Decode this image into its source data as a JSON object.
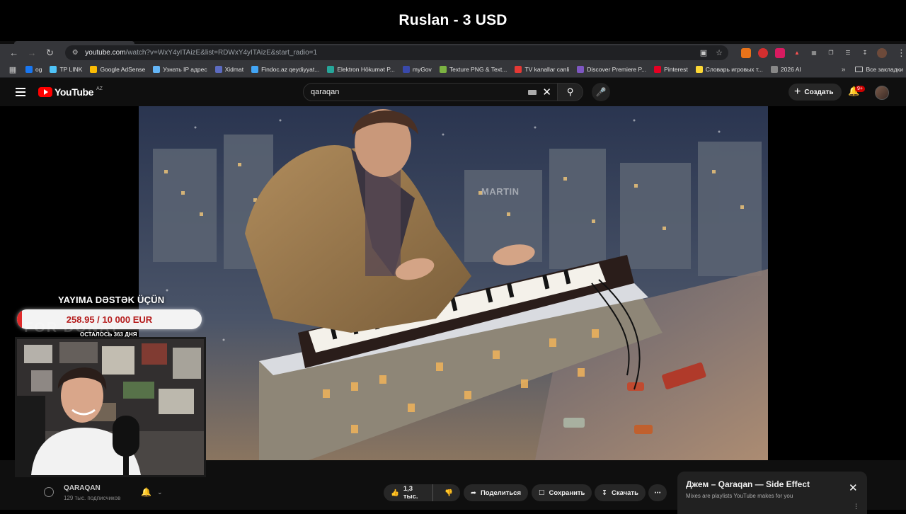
{
  "stream": {
    "title": "Ruslan - 3 USD"
  },
  "browser": {
    "url_host": "youtube.com",
    "url_path": "/watch?v=WxY4yITAizE&list=RDWxY4yITAizE&start_radio=1",
    "bookmarks": [
      {
        "label": "og",
        "color": "#1877f2"
      },
      {
        "label": "TP LINK",
        "color": "#4fc3f7"
      },
      {
        "label": "Google AdSense",
        "color": "#fbbc04"
      },
      {
        "label": "Узнать IP адрес",
        "color": "#64b5f6"
      },
      {
        "label": "Xidmat",
        "color": "#5c6bc0"
      },
      {
        "label": "Findoc.az qeydiyyat...",
        "color": "#42a5f5"
      },
      {
        "label": "Elektron Hökumət P...",
        "color": "#26a69a"
      },
      {
        "label": "myGov",
        "color": "#3949ab"
      },
      {
        "label": "Texture PNG & Text...",
        "color": "#7cb342"
      },
      {
        "label": "TV kanallar canli",
        "color": "#e53935"
      },
      {
        "label": "Discover Premiere P...",
        "color": "#7e57c2"
      },
      {
        "label": "Pinterest",
        "color": "#e60023"
      },
      {
        "label": "Словарь игровых т...",
        "color": "#fdd835"
      },
      {
        "label": "2026 AI",
        "color": "#888888"
      }
    ],
    "all_bookmarks": "Все закладки"
  },
  "youtube": {
    "logo_text": "YouTube",
    "country": "AZ",
    "search_value": "qaraqan",
    "create_label": "Создать",
    "notif_badge": "9+"
  },
  "video": {
    "watermark": "MARTIN"
  },
  "actions": {
    "likes": "1,3 тыс.",
    "share": "Поделиться",
    "save": "Сохранить",
    "download": "Скачать"
  },
  "channel": {
    "name": "QARAQAN",
    "subscribers": "129 тыс. подписчиков"
  },
  "mix": {
    "title": "Джем – Qaraqan — Side Effect",
    "subtitle": "Mixes are playlists YouTube makes for you"
  },
  "overlay": {
    "donate_heading": "YAYIMA DƏSTƏK ÜÇÜN",
    "donate_amount": "258.95 / 10 000 EUR",
    "donate_progress": 0.026,
    "donate_remaining": "ОСТАЛОСЬ 363 ДНЯ",
    "ghost_text": "FOR DONAT"
  },
  "colors": {
    "yt_red": "#ff0000",
    "donate_red": "#e02a2a",
    "bg_dark": "#0f0f0f"
  }
}
